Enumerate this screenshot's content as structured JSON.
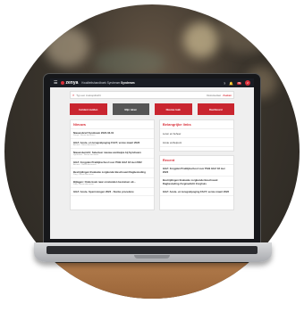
{
  "app": {
    "logo": "zenya",
    "breadcrumb_prefix": "Kwaliteitshandboek Syndream",
    "breadcrumb_current": "Syndream",
    "notification_count": "99"
  },
  "search": {
    "placeholder": "Typ een zoekopdracht",
    "filter": "Documenten",
    "button": "Zoeken"
  },
  "tiles": [
    {
      "label": "Incident melden"
    },
    {
      "label": "Mijn taken"
    },
    {
      "label": "Nieuwe taak"
    },
    {
      "label": "Dashboard"
    }
  ],
  "nieuws": {
    "title": "Nieuws",
    "items": [
      {
        "title": "Nieuwsbrief Syndream 2022-03-01",
        "sub": "Zenya - Nieuw document"
      },
      {
        "title": "GGZ: Acute- en terugvalpoging FACT, versie maart 2022",
        "sub": "Actueel - Nieuw document"
      },
      {
        "title": "Nieuwsbericht: Selecteer nieuwe werkwijze bij Syndream",
        "sub": "Syndream - Nieuw document"
      },
      {
        "title": "GGZ: Zorgplan Praktijkschool voor PGB GGZ 18 mei 2022",
        "sub": "Actueel - Nieuw document"
      },
      {
        "title": "Bestrijdingen Evaluatie zorgkunde Beschouwt Dagbesteding",
        "sub": "Zorg - Nieuw document"
      },
      {
        "title": "Bijlagen: Onderzoek naar omstanden bestuiven uit...",
        "sub": "Zorg - Nieuw document"
      },
      {
        "title": "GGZ: Acute- Spermotogen 2022 - Sterke procedure",
        "sub": ""
      }
    ]
  },
  "favorieten": {
    "title": "Belangrijke links",
    "items": [
      {
        "label": "Leren en beheer"
      },
      {
        "label": "Acute verbetpunt"
      }
    ]
  },
  "recent": {
    "title": "Recent",
    "items": [
      {
        "title": "GGZ: Zorgplan Praktijkschool voor PGB GGZ 18 mei 2022",
        "sub": ""
      },
      {
        "title": "Bestrijdingen Evaluatie zorgkunde Beschouwt Dagbesteding Zorgmedicht Zorghuis",
        "sub": ""
      },
      {
        "title": "GGZ: Acute- en terugvalpoging FACT, versie maart 2022",
        "sub": ""
      }
    ]
  }
}
